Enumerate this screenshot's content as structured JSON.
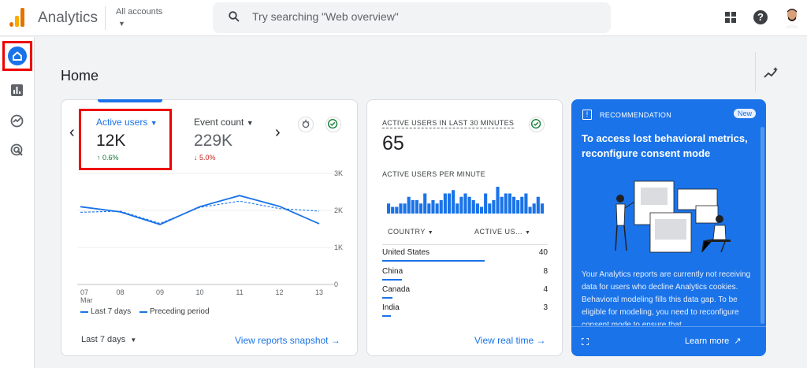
{
  "app": {
    "title": "Analytics",
    "accounts_label": "All accounts",
    "search_placeholder": "Try searching \"Web overview\""
  },
  "page": {
    "title": "Home"
  },
  "overview_card": {
    "metric1": {
      "label": "Active users",
      "value": "12K",
      "change": "0.6%"
    },
    "metric2": {
      "label": "Event count",
      "value": "229K",
      "change": "5.0%"
    },
    "legend_current": "Last 7 days",
    "legend_previous": "Preceding period",
    "date_range": "Last 7 days",
    "link": "View reports snapshot"
  },
  "chart_data": {
    "type": "line",
    "categories": [
      "07",
      "08",
      "09",
      "10",
      "11",
      "12",
      "13"
    ],
    "x_sublabel": "Mar",
    "y_ticks": [
      "3K",
      "2K",
      "1K",
      "0"
    ],
    "ylim": [
      0,
      3000
    ],
    "series": [
      {
        "name": "Last 7 days",
        "style": "solid",
        "values": [
          2100,
          1960,
          1620,
          2100,
          2400,
          2110,
          1640
        ]
      },
      {
        "name": "Preceding period",
        "style": "dashed",
        "values": [
          1950,
          1980,
          1650,
          2080,
          2250,
          2050,
          1980
        ]
      }
    ]
  },
  "realtime_card": {
    "title": "ACTIVE USERS IN LAST 30 MINUTES",
    "value": "65",
    "subtitle": "ACTIVE USERS PER MINUTE",
    "per_minute": [
      3,
      2,
      2,
      3,
      3,
      5,
      4,
      4,
      3,
      6,
      3,
      4,
      3,
      4,
      6,
      6,
      7,
      3,
      5,
      6,
      5,
      4,
      3,
      2,
      6,
      3,
      4,
      8,
      5,
      6,
      6,
      5,
      4,
      5,
      6,
      2,
      3,
      5,
      3
    ],
    "col_country": "COUNTRY",
    "col_users": "ACTIVE US...",
    "rows": [
      {
        "country": "United States",
        "value": "40",
        "share": 0.62
      },
      {
        "country": "China",
        "value": "8",
        "share": 0.12
      },
      {
        "country": "Canada",
        "value": "4",
        "share": 0.06
      },
      {
        "country": "India",
        "value": "3",
        "share": 0.05
      }
    ],
    "link": "View real time"
  },
  "recommendation": {
    "label": "RECOMMENDATION",
    "badge": "New",
    "title": "To access lost behavioral metrics, reconfigure consent mode",
    "body": "Your Analytics reports are currently not receiving data for users who decline Analytics cookies. Behavioral modeling fills this data gap. To be eligible for modeling, you need to reconfigure consent mode to ensure that",
    "link": "Learn more"
  },
  "colors": {
    "accent": "#1a73e8",
    "highlight": "#ee0000",
    "positive": "#137333",
    "negative": "#c5221f"
  }
}
